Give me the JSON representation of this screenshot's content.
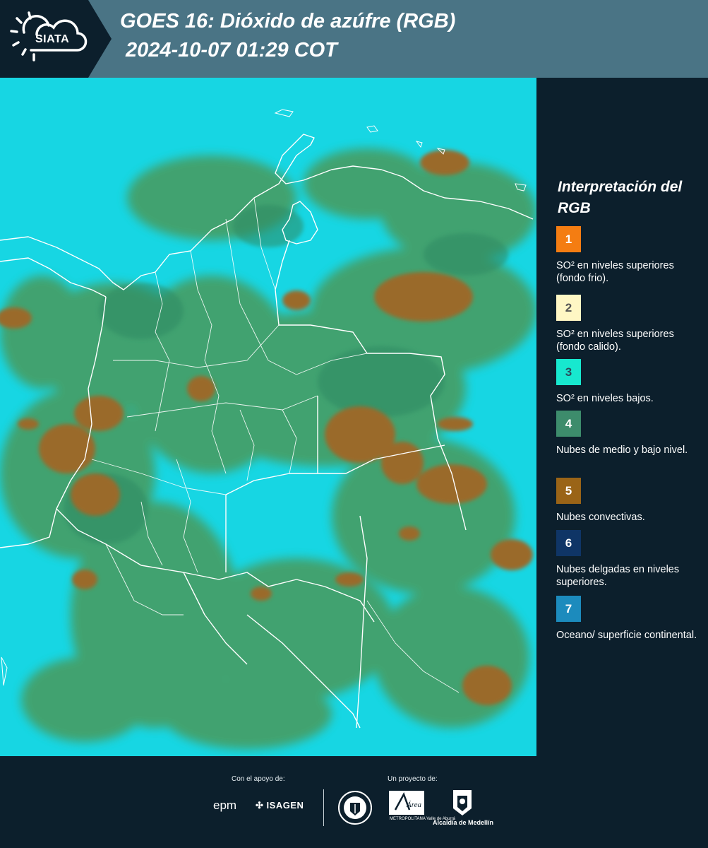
{
  "header": {
    "logo_text": "SIATA",
    "title_line1": "GOES 16: Dióxido de azúfre (RGB)",
    "title_line2": "2024-10-07 01:29 COT"
  },
  "map": {
    "background_color": "#17d6e3",
    "border_color": "#ffffff",
    "layers": [
      "convective-clouds",
      "mid-low-clouds",
      "country-borders",
      "department-borders"
    ]
  },
  "legend": {
    "title": "Interpretación del RGB",
    "items": [
      {
        "number": "1",
        "color": "#f47d12",
        "text_color": "#ffffff",
        "label": "SO² en niveles superiores (fondo frio)."
      },
      {
        "number": "2",
        "color": "#fff7c4",
        "text_color": "#555555",
        "label": "SO² en niveles superiores (fondo calido)."
      },
      {
        "number": "3",
        "color": "#17e8cf",
        "text_color": "#2b4a5a",
        "label": "SO² en niveles bajos."
      },
      {
        "number": "4",
        "color": "#3d8c6c",
        "text_color": "#ffffff",
        "label": "Nubes de medio y bajo nivel."
      },
      {
        "number": "5",
        "color": "#9a6417",
        "text_color": "#ffffff",
        "label": "Nubes convectivas."
      },
      {
        "number": "6",
        "color": "#0f3566",
        "text_color": "#ffffff",
        "label": "Nubes delgadas en niveles superiores."
      },
      {
        "number": "7",
        "color": "#1c8bbd",
        "text_color": "#ffffff",
        "label": "Oceano/ superficie continental."
      }
    ]
  },
  "footer": {
    "support_label": "Con el apoyo de:",
    "project_label": "Un proyecto de:",
    "sponsor1": "epm",
    "sponsor2": "ISAGEN",
    "partner1_label": "Área",
    "partner1_sub": "METROPOLITANA Valle de Aburrá",
    "partner2_label": "Alcaldía de Medellín"
  }
}
